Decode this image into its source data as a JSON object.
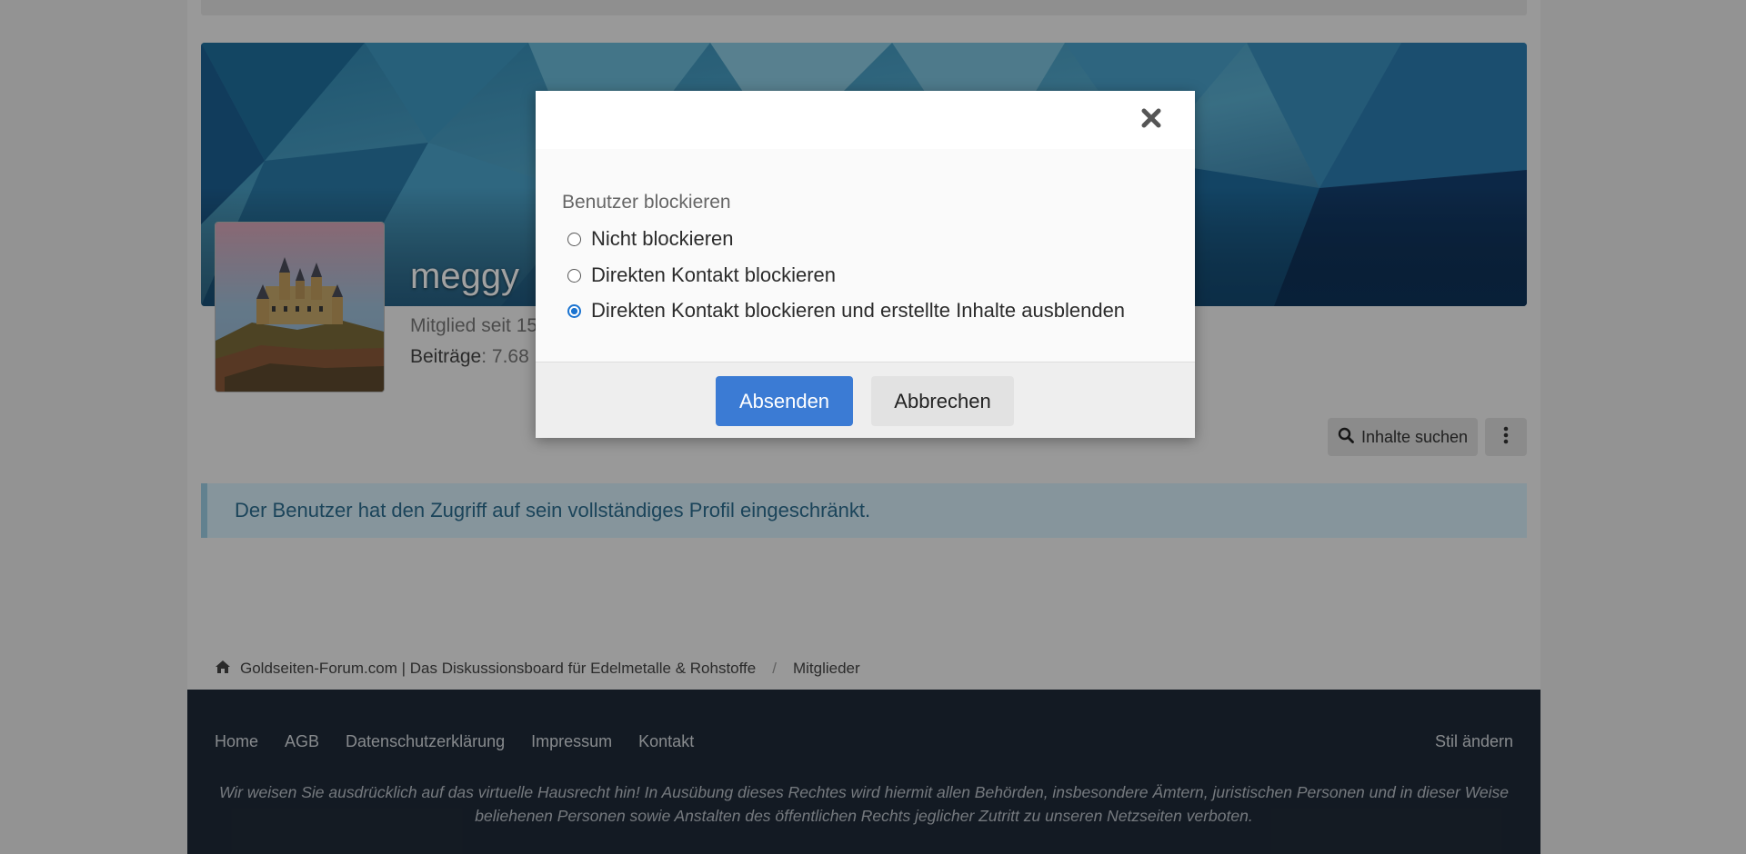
{
  "colors": {
    "primary": "#3b7bd4",
    "alert_text": "#2c6d8f",
    "footer_bg": "#1f2a38"
  },
  "profile": {
    "username": "meggy",
    "member_since": "Mitglied seit 15",
    "posts_label": "Beiträge",
    "posts_value": ": 7.68",
    "avatar_icon": "castle-photo"
  },
  "actions": {
    "search_label": "Inhalte suchen",
    "search_icon": "search-icon",
    "more_icon": "vertical-ellipsis-icon"
  },
  "alert": {
    "text": "Der Benutzer hat den Zugriff auf sein vollständiges Profil eingeschränkt."
  },
  "breadcrumb": {
    "home_icon": "home-icon",
    "items": [
      "Goldseiten-Forum.com | Das Diskussionsboard für Edelmetalle & Rohstoffe",
      "Mitglieder"
    ],
    "separator": "/"
  },
  "footer": {
    "nav": [
      "Home",
      "AGB",
      "Datenschutzerklärung",
      "Impressum",
      "Kontakt"
    ],
    "style_link": "Stil ändern",
    "note_line1": "Wir weisen Sie ausdrücklich auf das virtuelle Hausrecht hin! In Ausübung dieses Rechtes wird hiermit allen Behörden, insbesondere Ämtern, juristischen Personen und in dieser Weise",
    "note_line2": "beliehenen Personen sowie Anstalten des öffentlichen Rechts jeglicher Zutritt zu unseren Netzseiten verboten."
  },
  "modal": {
    "close_icon": "close-icon",
    "label": "Benutzer blockieren",
    "options": [
      {
        "label": "Nicht blockieren",
        "checked": false
      },
      {
        "label": "Direkten Kontakt blockieren",
        "checked": false
      },
      {
        "label": "Direkten Kontakt blockieren und erstellte Inhalte ausblenden",
        "checked": true
      }
    ],
    "submit": "Absenden",
    "cancel": "Abbrechen"
  }
}
